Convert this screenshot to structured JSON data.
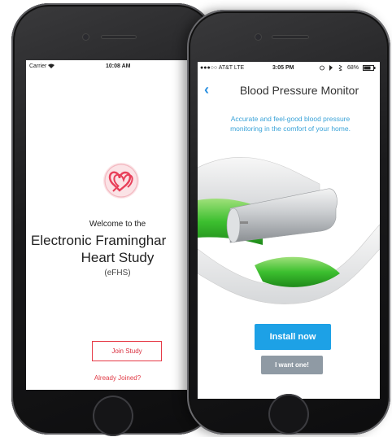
{
  "left_phone": {
    "status": {
      "carrier": "Carrier",
      "time": "10:08 AM"
    },
    "welcome_line": "Welcome to the",
    "title_line1": "Electronic Framinghar",
    "title_line2": "Heart Study",
    "abbrev": "(eFHS)",
    "join_button": "Join Study",
    "already_joined": "Already Joined?",
    "logo_color": "#e8405a"
  },
  "right_phone": {
    "status": {
      "carrier": "●●●○○ AT&T  LTE",
      "time": "3:05 PM",
      "battery": "68%"
    },
    "nav_title": "Blood Pressure Monitor",
    "tagline_line1": "Accurate and feel-good blood pressure",
    "tagline_line2": "monitoring in the comfort of your home.",
    "install_button": "Install now",
    "want_button": "I want one!",
    "accent_color": "#1da1e6"
  }
}
